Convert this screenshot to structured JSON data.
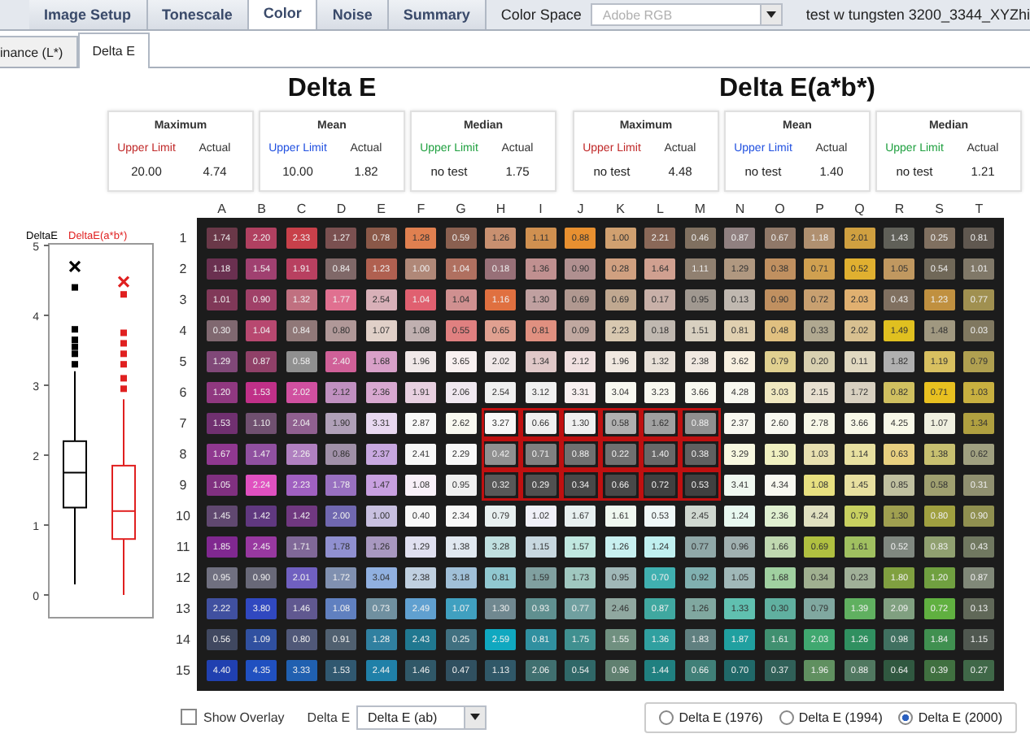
{
  "tabs": [
    {
      "label": "Image Setup",
      "selected": false
    },
    {
      "label": "Tonescale",
      "selected": false
    },
    {
      "label": "Color",
      "selected": true
    },
    {
      "label": "Noise",
      "selected": false
    },
    {
      "label": "Summary",
      "selected": false
    }
  ],
  "color_space": {
    "label": "Color Space",
    "value": "Adobe RGB",
    "disabled": true
  },
  "file_name": "test w tungsten 3200_3344_XYZhi",
  "subtabs": [
    {
      "label": "inance (L*)",
      "selected": false
    },
    {
      "label": "Delta E",
      "selected": true
    }
  ],
  "sections": [
    {
      "title": "Delta E",
      "stats": [
        {
          "name": "Maximum",
          "color": "#c02828",
          "limit_label": "Upper Limit",
          "actual_label": "Actual",
          "limit": "20.00",
          "actual": "4.74"
        },
        {
          "name": "Mean",
          "color": "#2050e0",
          "limit_label": "Upper Limit",
          "actual_label": "Actual",
          "limit": "10.00",
          "actual": "1.82"
        },
        {
          "name": "Median",
          "color": "#20a040",
          "limit_label": "Upper Limit",
          "actual_label": "Actual",
          "limit": "no test",
          "actual": "1.75"
        }
      ]
    },
    {
      "title": "Delta E(a*b*)",
      "stats": [
        {
          "name": "Maximum",
          "color": "#c02828",
          "limit_label": "Upper Limit",
          "actual_label": "Actual",
          "limit": "no test",
          "actual": "4.48"
        },
        {
          "name": "Mean",
          "color": "#2050e0",
          "limit_label": "Upper Limit",
          "actual_label": "Actual",
          "limit": "no test",
          "actual": "1.40"
        },
        {
          "name": "Median",
          "color": "#20a040",
          "limit_label": "Upper Limit",
          "actual_label": "Actual",
          "limit": "no test",
          "actual": "1.21"
        }
      ]
    }
  ],
  "boxplot": {
    "ticks": [
      "5",
      "4",
      "3",
      "2",
      "1",
      "0"
    ],
    "series": [
      {
        "name": "DeltaE",
        "color": "#000000"
      },
      {
        "name": "DeltaE(a*b*)",
        "color": "#e02020"
      }
    ]
  },
  "grid": {
    "columns": [
      "A",
      "B",
      "C",
      "D",
      "E",
      "F",
      "G",
      "H",
      "I",
      "J",
      "K",
      "L",
      "M",
      "N",
      "O",
      "P",
      "Q",
      "R",
      "S",
      "T"
    ],
    "rows": [
      {
        "label": "1",
        "cells": [
          {
            "value": "1.74",
            "color": "#6a3848",
            "selected": false
          },
          {
            "value": "2.20",
            "color": "#b04060",
            "selected": false
          },
          {
            "value": "2.33",
            "color": "#c8404a",
            "selected": false
          },
          {
            "value": "1.27",
            "color": "#7a5050",
            "selected": false
          },
          {
            "value": "0.78",
            "color": "#8a5848",
            "selected": false
          },
          {
            "value": "1.28",
            "color": "#e08050",
            "selected": false
          },
          {
            "value": "0.59",
            "color": "#8a6050",
            "selected": false
          },
          {
            "value": "1.26",
            "color": "#c89070",
            "selected": false
          },
          {
            "value": "1.11",
            "color": "#d09050",
            "selected": false
          },
          {
            "value": "0.88",
            "color": "#e89030",
            "selected": false
          },
          {
            "value": "1.00",
            "color": "#d0a070",
            "selected": false
          },
          {
            "value": "2.21",
            "color": "#8a6858",
            "selected": false
          },
          {
            "value": "0.46",
            "color": "#807060",
            "selected": false
          },
          {
            "value": "0.87",
            "color": "#908080",
            "selected": false
          },
          {
            "value": "0.67",
            "color": "#907868",
            "selected": false
          },
          {
            "value": "1.18",
            "color": "#b09070",
            "selected": false
          },
          {
            "value": "2.01",
            "color": "#d0a040",
            "selected": false
          },
          {
            "value": "1.43",
            "color": "#606058",
            "selected": false
          },
          {
            "value": "0.25",
            "color": "#807060",
            "selected": false
          },
          {
            "value": "0.81",
            "color": "#605850",
            "selected": false
          }
        ]
      },
      {
        "label": "2",
        "cells": [
          {
            "value": "1.18",
            "color": "#6a3050",
            "selected": false
          },
          {
            "value": "1.54",
            "color": "#a04070",
            "selected": false
          },
          {
            "value": "1.91",
            "color": "#b84060",
            "selected": false
          },
          {
            "value": "0.84",
            "color": "#806868",
            "selected": false
          },
          {
            "value": "1.23",
            "color": "#b06050",
            "selected": false
          },
          {
            "value": "1.00",
            "color": "#b08878",
            "selected": false
          },
          {
            "value": "1.04",
            "color": "#b07060",
            "selected": false
          },
          {
            "value": "0.18",
            "color": "#987078",
            "selected": false
          },
          {
            "value": "1.36",
            "color": "#c09090",
            "selected": false
          },
          {
            "value": "0.90",
            "color": "#b09090",
            "selected": false
          },
          {
            "value": "0.28",
            "color": "#d0a080",
            "selected": false
          },
          {
            "value": "1.64",
            "color": "#d0a090",
            "selected": false
          },
          {
            "value": "1.11",
            "color": "#908070",
            "selected": false
          },
          {
            "value": "1.29",
            "color": "#b09880",
            "selected": false
          },
          {
            "value": "0.38",
            "color": "#c09060",
            "selected": false
          },
          {
            "value": "0.71",
            "color": "#d0a050",
            "selected": false
          },
          {
            "value": "0.52",
            "color": "#e0b030",
            "selected": false
          },
          {
            "value": "1.05",
            "color": "#c09860",
            "selected": false
          },
          {
            "value": "0.54",
            "color": "#706858",
            "selected": false
          },
          {
            "value": "1.01",
            "color": "#807868",
            "selected": false
          }
        ]
      },
      {
        "label": "3",
        "cells": [
          {
            "value": "1.01",
            "color": "#803858",
            "selected": false
          },
          {
            "value": "0.90",
            "color": "#a04068",
            "selected": false
          },
          {
            "value": "1.32",
            "color": "#c07080",
            "selected": false
          },
          {
            "value": "1.77",
            "color": "#e07090",
            "selected": false
          },
          {
            "value": "2.54",
            "color": "#d8b0b8",
            "selected": false
          },
          {
            "value": "1.04",
            "color": "#e06070",
            "selected": false
          },
          {
            "value": "1.04",
            "color": "#d09090",
            "selected": false
          },
          {
            "value": "1.16",
            "color": "#e07040",
            "selected": false
          },
          {
            "value": "1.30",
            "color": "#c0a0a0",
            "selected": false
          },
          {
            "value": "0.69",
            "color": "#b09890",
            "selected": false
          },
          {
            "value": "0.69",
            "color": "#c0a890",
            "selected": false
          },
          {
            "value": "0.17",
            "color": "#c8b0a8",
            "selected": false
          },
          {
            "value": "0.95",
            "color": "#a09890",
            "selected": false
          },
          {
            "value": "0.13",
            "color": "#c0b8b0",
            "selected": false
          },
          {
            "value": "0.90",
            "color": "#c09060",
            "selected": false
          },
          {
            "value": "0.72",
            "color": "#c8a070",
            "selected": false
          },
          {
            "value": "2.03",
            "color": "#e0b070",
            "selected": false
          },
          {
            "value": "0.43",
            "color": "#807060",
            "selected": false
          },
          {
            "value": "1.23",
            "color": "#c09040",
            "selected": false
          },
          {
            "value": "0.77",
            "color": "#a09050",
            "selected": false
          }
        ]
      },
      {
        "label": "4",
        "cells": [
          {
            "value": "0.30",
            "color": "#806870",
            "selected": false
          },
          {
            "value": "1.04",
            "color": "#b84870",
            "selected": false
          },
          {
            "value": "0.84",
            "color": "#907878",
            "selected": false
          },
          {
            "value": "0.80",
            "color": "#b09898",
            "selected": false
          },
          {
            "value": "1.07",
            "color": "#e0d0c8",
            "selected": false
          },
          {
            "value": "1.08",
            "color": "#c0b0b0",
            "selected": false
          },
          {
            "value": "0.55",
            "color": "#e08080",
            "selected": false
          },
          {
            "value": "0.65",
            "color": "#e0a090",
            "selected": false
          },
          {
            "value": "0.81",
            "color": "#e09080",
            "selected": false
          },
          {
            "value": "0.09",
            "color": "#c0a8a0",
            "selected": false
          },
          {
            "value": "2.23",
            "color": "#d8c8b0",
            "selected": false
          },
          {
            "value": "0.18",
            "color": "#c0b8b0",
            "selected": false
          },
          {
            "value": "1.51",
            "color": "#d8d0c0",
            "selected": false
          },
          {
            "value": "0.81",
            "color": "#e0d0b0",
            "selected": false
          },
          {
            "value": "0.48",
            "color": "#e0c080",
            "selected": false
          },
          {
            "value": "0.33",
            "color": "#b0a890",
            "selected": false
          },
          {
            "value": "2.02",
            "color": "#d8c090",
            "selected": false
          },
          {
            "value": "1.49",
            "color": "#e0c020",
            "selected": false
          },
          {
            "value": "1.48",
            "color": "#a09880",
            "selected": false
          },
          {
            "value": "0.03",
            "color": "#807860",
            "selected": false
          }
        ]
      },
      {
        "label": "5",
        "cells": [
          {
            "value": "1.29",
            "color": "#804878",
            "selected": false
          },
          {
            "value": "0.87",
            "color": "#904068",
            "selected": false
          },
          {
            "value": "0.58",
            "color": "#909090",
            "selected": false
          },
          {
            "value": "2.40",
            "color": "#d06098",
            "selected": false
          },
          {
            "value": "1.68",
            "color": "#d8a0c8",
            "selected": false
          },
          {
            "value": "1.96",
            "color": "#f0e8e8",
            "selected": false
          },
          {
            "value": "3.65",
            "color": "#f8f0f0",
            "selected": false
          },
          {
            "value": "2.02",
            "color": "#f0e8e8",
            "selected": false
          },
          {
            "value": "1.34",
            "color": "#e0c8c8",
            "selected": false
          },
          {
            "value": "2.12",
            "color": "#f0e0e0",
            "selected": false
          },
          {
            "value": "1.96",
            "color": "#f0e8e0",
            "selected": false
          },
          {
            "value": "1.32",
            "color": "#e8e0d8",
            "selected": false
          },
          {
            "value": "2.38",
            "color": "#f0e8e0",
            "selected": false
          },
          {
            "value": "3.62",
            "color": "#f8f0e0",
            "selected": false
          },
          {
            "value": "0.79",
            "color": "#e0d090",
            "selected": false
          },
          {
            "value": "0.20",
            "color": "#d8d0b0",
            "selected": false
          },
          {
            "value": "0.11",
            "color": "#e0d8c0",
            "selected": false
          },
          {
            "value": "1.82",
            "color": "#b0b0b0",
            "selected": false
          },
          {
            "value": "1.19",
            "color": "#d8c060",
            "selected": false
          },
          {
            "value": "0.79",
            "color": "#b0a050",
            "selected": false
          }
        ]
      },
      {
        "label": "6",
        "cells": [
          {
            "value": "1.20",
            "color": "#903880",
            "selected": false
          },
          {
            "value": "1.53",
            "color": "#c03088",
            "selected": false
          },
          {
            "value": "2.02",
            "color": "#d050a0",
            "selected": false
          },
          {
            "value": "2.12",
            "color": "#c090c0",
            "selected": false
          },
          {
            "value": "2.36",
            "color": "#d8a8d0",
            "selected": false
          },
          {
            "value": "1.91",
            "color": "#e8d0e0",
            "selected": false
          },
          {
            "value": "2.06",
            "color": "#f0e8f0",
            "selected": false
          },
          {
            "value": "2.54",
            "color": "#f0f0f0",
            "selected": false
          },
          {
            "value": "3.12",
            "color": "#f0f0f0",
            "selected": false
          },
          {
            "value": "3.31",
            "color": "#f8f0f0",
            "selected": false
          },
          {
            "value": "3.04",
            "color": "#f8f8f0",
            "selected": false
          },
          {
            "value": "3.23",
            "color": "#f8f8f0",
            "selected": false
          },
          {
            "value": "3.66",
            "color": "#f8f8f0",
            "selected": false
          },
          {
            "value": "4.28",
            "color": "#f8f8f0",
            "selected": false
          },
          {
            "value": "3.03",
            "color": "#f0e8c0",
            "selected": false
          },
          {
            "value": "2.15",
            "color": "#e8e0d0",
            "selected": false
          },
          {
            "value": "1.72",
            "color": "#d8d0c0",
            "selected": false
          },
          {
            "value": "0.82",
            "color": "#d0c060",
            "selected": false
          },
          {
            "value": "0.71",
            "color": "#e8c020",
            "selected": false
          },
          {
            "value": "1.03",
            "color": "#c8b040",
            "selected": false
          }
        ]
      },
      {
        "label": "7",
        "cells": [
          {
            "value": "1.53",
            "color": "#703070",
            "selected": false
          },
          {
            "value": "1.10",
            "color": "#705070",
            "selected": false
          },
          {
            "value": "2.04",
            "color": "#906090",
            "selected": false
          },
          {
            "value": "1.90",
            "color": "#b0a0b8",
            "selected": false
          },
          {
            "value": "3.31",
            "color": "#e8d8f0",
            "selected": false
          },
          {
            "value": "2.87",
            "color": "#f8f8f8",
            "selected": false
          },
          {
            "value": "2.62",
            "color": "#f8f8f0",
            "selected": false
          },
          {
            "value": "3.27",
            "color": "#f8f8f8",
            "selected": true
          },
          {
            "value": "0.66",
            "color": "#f0f0f0",
            "selected": true
          },
          {
            "value": "1.30",
            "color": "#f0f0f0",
            "selected": true
          },
          {
            "value": "0.58",
            "color": "#b0b0b0",
            "selected": true
          },
          {
            "value": "1.62",
            "color": "#a0a0a0",
            "selected": true
          },
          {
            "value": "0.88",
            "color": "#909090",
            "selected": true
          },
          {
            "value": "2.37",
            "color": "#f8f8f0",
            "selected": false
          },
          {
            "value": "2.60",
            "color": "#f8f8f0",
            "selected": false
          },
          {
            "value": "2.78",
            "color": "#f8f8e8",
            "selected": false
          },
          {
            "value": "3.66",
            "color": "#f8f8e8",
            "selected": false
          },
          {
            "value": "4.25",
            "color": "#f8f8e8",
            "selected": false
          },
          {
            "value": "1.07",
            "color": "#f0f0e0",
            "selected": false
          },
          {
            "value": "1.34",
            "color": "#b0a040",
            "selected": false
          }
        ]
      },
      {
        "label": "8",
        "cells": [
          {
            "value": "1.67",
            "color": "#903890",
            "selected": false
          },
          {
            "value": "1.47",
            "color": "#9050a0",
            "selected": false
          },
          {
            "value": "2.26",
            "color": "#b080c0",
            "selected": false
          },
          {
            "value": "0.86",
            "color": "#a090a8",
            "selected": false
          },
          {
            "value": "2.37",
            "color": "#c8a8e0",
            "selected": false
          },
          {
            "value": "2.41",
            "color": "#f8f8f8",
            "selected": false
          },
          {
            "value": "2.29",
            "color": "#f8f8f8",
            "selected": false
          },
          {
            "value": "0.42",
            "color": "#909090",
            "selected": true
          },
          {
            "value": "0.71",
            "color": "#808080",
            "selected": true
          },
          {
            "value": "0.88",
            "color": "#707070",
            "selected": true
          },
          {
            "value": "0.22",
            "color": "#707070",
            "selected": true
          },
          {
            "value": "1.40",
            "color": "#686868",
            "selected": true
          },
          {
            "value": "0.38",
            "color": "#606060",
            "selected": true
          },
          {
            "value": "3.29",
            "color": "#f8f8e0",
            "selected": false
          },
          {
            "value": "1.30",
            "color": "#f0f0c0",
            "selected": false
          },
          {
            "value": "1.03",
            "color": "#e8e0b0",
            "selected": false
          },
          {
            "value": "1.14",
            "color": "#e8e0a0",
            "selected": false
          },
          {
            "value": "0.63",
            "color": "#e8d080",
            "selected": false
          },
          {
            "value": "1.38",
            "color": "#c8c070",
            "selected": false
          },
          {
            "value": "0.62",
            "color": "#a0a080",
            "selected": false
          }
        ]
      },
      {
        "label": "9",
        "cells": [
          {
            "value": "1.05",
            "color": "#803080",
            "selected": false
          },
          {
            "value": "2.24",
            "color": "#e050c0",
            "selected": false
          },
          {
            "value": "2.23",
            "color": "#a060c0",
            "selected": false
          },
          {
            "value": "1.78",
            "color": "#9870c0",
            "selected": false
          },
          {
            "value": "1.47",
            "color": "#c8a0e0",
            "selected": false
          },
          {
            "value": "1.08",
            "color": "#f8f0f8",
            "selected": false
          },
          {
            "value": "0.95",
            "color": "#f0f0f0",
            "selected": false
          },
          {
            "value": "0.32",
            "color": "#585858",
            "selected": true
          },
          {
            "value": "0.29",
            "color": "#505050",
            "selected": true
          },
          {
            "value": "0.34",
            "color": "#484848",
            "selected": true
          },
          {
            "value": "0.66",
            "color": "#484848",
            "selected": true
          },
          {
            "value": "0.72",
            "color": "#404040",
            "selected": true
          },
          {
            "value": "0.53",
            "color": "#404040",
            "selected": true
          },
          {
            "value": "3.41",
            "color": "#f0f8f0",
            "selected": false
          },
          {
            "value": "4.34",
            "color": "#f8f8f0",
            "selected": false
          },
          {
            "value": "1.08",
            "color": "#e8e080",
            "selected": false
          },
          {
            "value": "1.45",
            "color": "#e8e0a0",
            "selected": false
          },
          {
            "value": "0.85",
            "color": "#c0c0a0",
            "selected": false
          },
          {
            "value": "0.58",
            "color": "#a0a070",
            "selected": false
          },
          {
            "value": "0.31",
            "color": "#909070",
            "selected": false
          }
        ]
      },
      {
        "label": "10",
        "cells": [
          {
            "value": "1.45",
            "color": "#604870",
            "selected": false
          },
          {
            "value": "1.42",
            "color": "#603880",
            "selected": false
          },
          {
            "value": "1.42",
            "color": "#703880",
            "selected": false
          },
          {
            "value": "2.00",
            "color": "#7068b0",
            "selected": false
          },
          {
            "value": "1.00",
            "color": "#c8c0e0",
            "selected": false
          },
          {
            "value": "0.40",
            "color": "#f8f8f8",
            "selected": false
          },
          {
            "value": "2.34",
            "color": "#f8f8f8",
            "selected": false
          },
          {
            "value": "0.79",
            "color": "#e8f0f0",
            "selected": false
          },
          {
            "value": "1.02",
            "color": "#f0f0f8",
            "selected": false
          },
          {
            "value": "1.67",
            "color": "#e8f0f0",
            "selected": false
          },
          {
            "value": "1.61",
            "color": "#f0f8f0",
            "selected": false
          },
          {
            "value": "0.53",
            "color": "#f0f8f8",
            "selected": false
          },
          {
            "value": "2.45",
            "color": "#d0d8d0",
            "selected": false
          },
          {
            "value": "1.24",
            "color": "#e8f8f0",
            "selected": false
          },
          {
            "value": "2.36",
            "color": "#e0f0d0",
            "selected": false
          },
          {
            "value": "4.24",
            "color": "#e0e0c0",
            "selected": false
          },
          {
            "value": "0.79",
            "color": "#c8d060",
            "selected": false
          },
          {
            "value": "1.30",
            "color": "#a0a050",
            "selected": false
          },
          {
            "value": "0.80",
            "color": "#a0a040",
            "selected": false
          },
          {
            "value": "0.90",
            "color": "#909050",
            "selected": false
          }
        ]
      },
      {
        "label": "11",
        "cells": [
          {
            "value": "1.85",
            "color": "#802890",
            "selected": false
          },
          {
            "value": "2.45",
            "color": "#9838a0",
            "selected": false
          },
          {
            "value": "1.71",
            "color": "#806898",
            "selected": false
          },
          {
            "value": "1.78",
            "color": "#9090d0",
            "selected": false
          },
          {
            "value": "1.26",
            "color": "#a898c0",
            "selected": false
          },
          {
            "value": "1.29",
            "color": "#e0e0f0",
            "selected": false
          },
          {
            "value": "1.38",
            "color": "#e0e8f0",
            "selected": false
          },
          {
            "value": "3.28",
            "color": "#c0e0e0",
            "selected": false
          },
          {
            "value": "1.15",
            "color": "#c8d8e0",
            "selected": false
          },
          {
            "value": "1.57",
            "color": "#c0e8e0",
            "selected": false
          },
          {
            "value": "1.26",
            "color": "#c8f0f0",
            "selected": false
          },
          {
            "value": "1.24",
            "color": "#c0f0f0",
            "selected": false
          },
          {
            "value": "0.77",
            "color": "#90a8a8",
            "selected": false
          },
          {
            "value": "0.96",
            "color": "#a0b0b0",
            "selected": false
          },
          {
            "value": "1.66",
            "color": "#c0d8b0",
            "selected": false
          },
          {
            "value": "0.69",
            "color": "#b0c040",
            "selected": false
          },
          {
            "value": "1.61",
            "color": "#a0c060",
            "selected": false
          },
          {
            "value": "0.52",
            "color": "#808880",
            "selected": false
          },
          {
            "value": "0.83",
            "color": "#90a070",
            "selected": false
          },
          {
            "value": "0.43",
            "color": "#707860",
            "selected": false
          }
        ]
      },
      {
        "label": "12",
        "cells": [
          {
            "value": "0.95",
            "color": "#707080",
            "selected": false
          },
          {
            "value": "0.90",
            "color": "#686878",
            "selected": false
          },
          {
            "value": "2.01",
            "color": "#7060c0",
            "selected": false
          },
          {
            "value": "1.72",
            "color": "#8090b0",
            "selected": false
          },
          {
            "value": "3.04",
            "color": "#90b0e0",
            "selected": false
          },
          {
            "value": "2.38",
            "color": "#c0d0e0",
            "selected": false
          },
          {
            "value": "3.18",
            "color": "#a0c0d8",
            "selected": false
          },
          {
            "value": "0.81",
            "color": "#90c8d0",
            "selected": false
          },
          {
            "value": "1.59",
            "color": "#80a0a0",
            "selected": false
          },
          {
            "value": "1.73",
            "color": "#a0c8c0",
            "selected": false
          },
          {
            "value": "0.95",
            "color": "#a0b8b8",
            "selected": false
          },
          {
            "value": "0.70",
            "color": "#40b0b0",
            "selected": false
          },
          {
            "value": "0.92",
            "color": "#80b0b0",
            "selected": false
          },
          {
            "value": "1.05",
            "color": "#a0b8b8",
            "selected": false
          },
          {
            "value": "1.68",
            "color": "#a0d0a0",
            "selected": false
          },
          {
            "value": "0.34",
            "color": "#a0b090",
            "selected": false
          },
          {
            "value": "0.23",
            "color": "#a0b098",
            "selected": false
          },
          {
            "value": "1.80",
            "color": "#80a040",
            "selected": false
          },
          {
            "value": "1.20",
            "color": "#70a040",
            "selected": false
          },
          {
            "value": "0.87",
            "color": "#808878",
            "selected": false
          }
        ]
      },
      {
        "label": "13",
        "cells": [
          {
            "value": "2.22",
            "color": "#4050a0",
            "selected": false
          },
          {
            "value": "3.80",
            "color": "#3048c0",
            "selected": false
          },
          {
            "value": "1.46",
            "color": "#605890",
            "selected": false
          },
          {
            "value": "1.08",
            "color": "#6080c0",
            "selected": false
          },
          {
            "value": "0.73",
            "color": "#7090a0",
            "selected": false
          },
          {
            "value": "2.49",
            "color": "#60a0d0",
            "selected": false
          },
          {
            "value": "1.07",
            "color": "#40a0c0",
            "selected": false
          },
          {
            "value": "1.30",
            "color": "#708890",
            "selected": false
          },
          {
            "value": "0.93",
            "color": "#609090",
            "selected": false
          },
          {
            "value": "0.77",
            "color": "#70a0a0",
            "selected": false
          },
          {
            "value": "2.46",
            "color": "#90a8a0",
            "selected": false
          },
          {
            "value": "0.87",
            "color": "#40a8a0",
            "selected": false
          },
          {
            "value": "1.26",
            "color": "#80a8a0",
            "selected": false
          },
          {
            "value": "1.33",
            "color": "#60c0b0",
            "selected": false
          },
          {
            "value": "0.30",
            "color": "#60b0a0",
            "selected": false
          },
          {
            "value": "0.79",
            "color": "#80a8a0",
            "selected": false
          },
          {
            "value": "1.39",
            "color": "#60b060",
            "selected": false
          },
          {
            "value": "2.09",
            "color": "#80a080",
            "selected": false
          },
          {
            "value": "0.72",
            "color": "#60b040",
            "selected": false
          },
          {
            "value": "0.13",
            "color": "#606858",
            "selected": false
          }
        ]
      },
      {
        "label": "14",
        "cells": [
          {
            "value": "0.56",
            "color": "#404860",
            "selected": false
          },
          {
            "value": "1.09",
            "color": "#3050a0",
            "selected": false
          },
          {
            "value": "0.80",
            "color": "#505878",
            "selected": false
          },
          {
            "value": "0.91",
            "color": "#506070",
            "selected": false
          },
          {
            "value": "1.28",
            "color": "#3080a0",
            "selected": false
          },
          {
            "value": "2.43",
            "color": "#207890",
            "selected": false
          },
          {
            "value": "0.25",
            "color": "#407080",
            "selected": false
          },
          {
            "value": "2.59",
            "color": "#10a8c0",
            "selected": false
          },
          {
            "value": "0.81",
            "color": "#3090a0",
            "selected": false
          },
          {
            "value": "1.75",
            "color": "#409090",
            "selected": false
          },
          {
            "value": "1.55",
            "color": "#709080",
            "selected": false
          },
          {
            "value": "1.36",
            "color": "#30a0a0",
            "selected": false
          },
          {
            "value": "1.83",
            "color": "#608080",
            "selected": false
          },
          {
            "value": "1.87",
            "color": "#20a0a0",
            "selected": false
          },
          {
            "value": "1.61",
            "color": "#409070",
            "selected": false
          },
          {
            "value": "2.03",
            "color": "#40a870",
            "selected": false
          },
          {
            "value": "1.26",
            "color": "#309060",
            "selected": false
          },
          {
            "value": "0.98",
            "color": "#407060",
            "selected": false
          },
          {
            "value": "1.84",
            "color": "#409050",
            "selected": false
          },
          {
            "value": "1.15",
            "color": "#505850",
            "selected": false
          }
        ]
      },
      {
        "label": "15",
        "cells": [
          {
            "value": "4.40",
            "color": "#2040b0",
            "selected": false
          },
          {
            "value": "4.35",
            "color": "#2050c0",
            "selected": false
          },
          {
            "value": "3.33",
            "color": "#2060b0",
            "selected": false
          },
          {
            "value": "1.53",
            "color": "#305870",
            "selected": false
          },
          {
            "value": "2.44",
            "color": "#2080a8",
            "selected": false
          },
          {
            "value": "1.46",
            "color": "#305868",
            "selected": false
          },
          {
            "value": "0.47",
            "color": "#305060",
            "selected": false
          },
          {
            "value": "1.13",
            "color": "#305868",
            "selected": false
          },
          {
            "value": "2.06",
            "color": "#407070",
            "selected": false
          },
          {
            "value": "0.54",
            "color": "#306868",
            "selected": false
          },
          {
            "value": "0.96",
            "color": "#608070",
            "selected": false
          },
          {
            "value": "1.44",
            "color": "#208080",
            "selected": false
          },
          {
            "value": "0.66",
            "color": "#408078",
            "selected": false
          },
          {
            "value": "0.70",
            "color": "#206868",
            "selected": false
          },
          {
            "value": "0.37",
            "color": "#306058",
            "selected": false
          },
          {
            "value": "1.96",
            "color": "#609060",
            "selected": false
          },
          {
            "value": "0.88",
            "color": "#507860",
            "selected": false
          },
          {
            "value": "0.64",
            "color": "#305840",
            "selected": false
          },
          {
            "value": "0.39",
            "color": "#407040",
            "selected": false
          },
          {
            "value": "0.27",
            "color": "#406848",
            "selected": false
          }
        ]
      }
    ]
  },
  "overlay": {
    "label": "Show Overlay",
    "checked": false
  },
  "metric": {
    "label": "Delta E",
    "value": "Delta E (ab)"
  },
  "formulas": [
    {
      "label": "Delta E (1976)",
      "selected": false
    },
    {
      "label": "Delta E (1994)",
      "selected": false
    },
    {
      "label": "Delta E (2000)",
      "selected": true
    }
  ]
}
